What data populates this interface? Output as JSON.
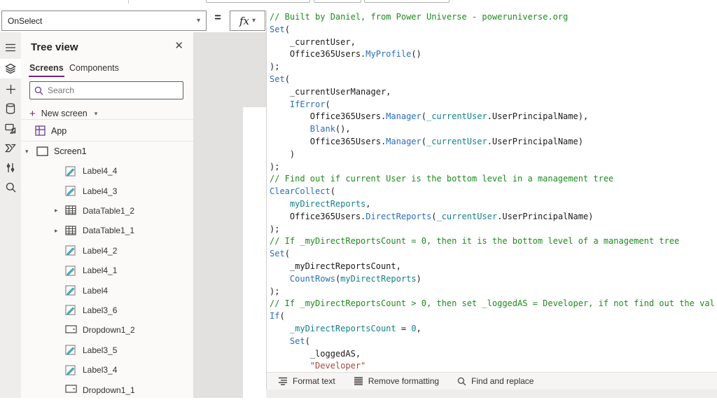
{
  "formula_bar": {
    "property": "OnSelect",
    "equals": "=",
    "fx_label": "fx"
  },
  "tree_panel": {
    "title": "Tree view",
    "close_icon": "close-icon",
    "tabs": [
      {
        "label": "Screens",
        "active": true
      },
      {
        "label": "Components",
        "active": false
      }
    ],
    "search_placeholder": "Search",
    "new_screen_label": "New screen",
    "app_label": "App",
    "screen_label": "Screen1",
    "items": [
      {
        "label": "Label4_4",
        "type": "label"
      },
      {
        "label": "Label4_3",
        "type": "label"
      },
      {
        "label": "DataTable1_2",
        "type": "datatable",
        "chevron": true
      },
      {
        "label": "DataTable1_1",
        "type": "datatable",
        "chevron": true
      },
      {
        "label": "Label4_2",
        "type": "label"
      },
      {
        "label": "Label4_1",
        "type": "label"
      },
      {
        "label": "Label4",
        "type": "label"
      },
      {
        "label": "Label3_6",
        "type": "label"
      },
      {
        "label": "Dropdown1_2",
        "type": "dropdown"
      },
      {
        "label": "Label3_5",
        "type": "label"
      },
      {
        "label": "Label3_4",
        "type": "label"
      },
      {
        "label": "Dropdown1_1",
        "type": "dropdown"
      }
    ]
  },
  "code": {
    "lines": [
      [
        {
          "c": "m",
          "t": "// Built by Daniel, from Power Universe - poweruniverse.org"
        }
      ],
      [
        {
          "c": "k",
          "t": "Set"
        },
        {
          "c": "t",
          "t": "("
        }
      ],
      [
        {
          "c": "t",
          "t": "    _currentUser,"
        }
      ],
      [
        {
          "c": "t",
          "t": "    Office365Users."
        },
        {
          "c": "k",
          "t": "MyProfile"
        },
        {
          "c": "t",
          "t": "()"
        }
      ],
      [
        {
          "c": "t",
          "t": ");"
        }
      ],
      [
        {
          "c": "k",
          "t": "Set"
        },
        {
          "c": "t",
          "t": "("
        }
      ],
      [
        {
          "c": "t",
          "t": "    _currentUserManager,"
        }
      ],
      [
        {
          "c": "t",
          "t": "    "
        },
        {
          "c": "k",
          "t": "IfError"
        },
        {
          "c": "t",
          "t": "("
        }
      ],
      [
        {
          "c": "t",
          "t": "        Office365Users."
        },
        {
          "c": "k",
          "t": "Manager"
        },
        {
          "c": "t",
          "t": "("
        },
        {
          "c": "v",
          "t": "_currentUser"
        },
        {
          "c": "t",
          "t": ".UserPrincipalName),"
        }
      ],
      [
        {
          "c": "t",
          "t": "        "
        },
        {
          "c": "k",
          "t": "Blank"
        },
        {
          "c": "t",
          "t": "(),"
        }
      ],
      [
        {
          "c": "t",
          "t": "        Office365Users."
        },
        {
          "c": "k",
          "t": "Manager"
        },
        {
          "c": "t",
          "t": "("
        },
        {
          "c": "v",
          "t": "_currentUser"
        },
        {
          "c": "t",
          "t": ".UserPrincipalName)"
        }
      ],
      [
        {
          "c": "t",
          "t": "    )"
        }
      ],
      [
        {
          "c": "t",
          "t": ");"
        }
      ],
      [
        {
          "c": "m",
          "t": "// Find out if current User is the bottom level in a management tree"
        }
      ],
      [
        {
          "c": "k",
          "t": "ClearCollect"
        },
        {
          "c": "t",
          "t": "("
        }
      ],
      [
        {
          "c": "t",
          "t": "    "
        },
        {
          "c": "v",
          "t": "myDirectReports"
        },
        {
          "c": "t",
          "t": ","
        }
      ],
      [
        {
          "c": "t",
          "t": "    Office365Users."
        },
        {
          "c": "k",
          "t": "DirectReports"
        },
        {
          "c": "t",
          "t": "("
        },
        {
          "c": "v",
          "t": "_currentUser"
        },
        {
          "c": "t",
          "t": ".UserPrincipalName)"
        }
      ],
      [
        {
          "c": "t",
          "t": ");"
        }
      ],
      [
        {
          "c": "m",
          "t": "// If _myDirectReportsCount = 0, then it is the bottom level of a management tree"
        }
      ],
      [
        {
          "c": "k",
          "t": "Set"
        },
        {
          "c": "t",
          "t": "("
        }
      ],
      [
        {
          "c": "t",
          "t": "    _myDirectReportsCount,"
        }
      ],
      [
        {
          "c": "t",
          "t": "    "
        },
        {
          "c": "k",
          "t": "CountRows"
        },
        {
          "c": "t",
          "t": "("
        },
        {
          "c": "v",
          "t": "myDirectReports"
        },
        {
          "c": "t",
          "t": ")"
        }
      ],
      [
        {
          "c": "t",
          "t": ");"
        }
      ],
      [
        {
          "c": "m",
          "t": "// If _myDirectReportsCount > 0, then set _loggedAS = Developer, if not find out the val"
        }
      ],
      [
        {
          "c": "k",
          "t": "If"
        },
        {
          "c": "t",
          "t": "("
        }
      ],
      [
        {
          "c": "t",
          "t": "    "
        },
        {
          "c": "v",
          "t": "_myDirectReportsCount"
        },
        {
          "c": "t",
          "t": " = "
        },
        {
          "c": "v",
          "t": "0"
        },
        {
          "c": "t",
          "t": ","
        }
      ],
      [
        {
          "c": "t",
          "t": "    "
        },
        {
          "c": "k",
          "t": "Set"
        },
        {
          "c": "t",
          "t": "("
        }
      ],
      [
        {
          "c": "t",
          "t": "        _loggedAS,"
        }
      ],
      [
        {
          "c": "t",
          "t": "        "
        },
        {
          "c": "s",
          "t": "\"Developer\""
        }
      ]
    ]
  },
  "bottom_toolbar": {
    "format_text": "Format text",
    "remove_formatting": "Remove formatting",
    "find_replace": "Find and replace"
  },
  "colors": {
    "accent_purple": "#742774",
    "keyword_blue": "#2a6dc0",
    "variable_teal": "#12808a",
    "comment_green": "#1e8a1e",
    "string_red": "#a4483e",
    "rail_bg": "#efedeb",
    "canvas_bg": "#e2e1df",
    "label_icon_teal": "#4db8c8"
  }
}
